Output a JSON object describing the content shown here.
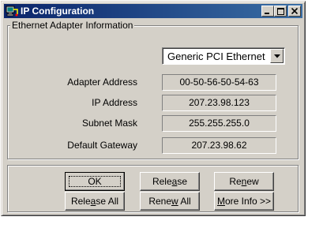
{
  "window": {
    "title": "IP Configuration",
    "icon": "network-config-icon",
    "controls": [
      "minimize",
      "maximize",
      "close"
    ]
  },
  "group": {
    "legend": "Ethernet  Adapter Information"
  },
  "adapter_select": {
    "selected": "Generic PCI Ethernet"
  },
  "fields": {
    "adapter_address": {
      "label": "Adapter Address",
      "value": "00-50-56-50-54-63"
    },
    "ip_address": {
      "label": "IP Address",
      "value": "207.23.98.123"
    },
    "subnet_mask": {
      "label": "Subnet Mask",
      "value": "255.255.255.0"
    },
    "default_gateway": {
      "label": "Default Gateway",
      "value": "207.23.98.62"
    }
  },
  "buttons": {
    "ok": {
      "pre": "OK",
      "ul": "",
      "post": ""
    },
    "release": {
      "pre": "Rele",
      "ul": "a",
      "post": "se"
    },
    "renew": {
      "pre": "Re",
      "ul": "n",
      "post": "ew"
    },
    "release_all": {
      "pre": "Rele",
      "ul": "a",
      "post": "se All"
    },
    "renew_all": {
      "pre": "Rene",
      "ul": "w",
      "post": " All"
    },
    "more_info": {
      "pre": "",
      "ul": "M",
      "post": "ore Info >>"
    }
  }
}
